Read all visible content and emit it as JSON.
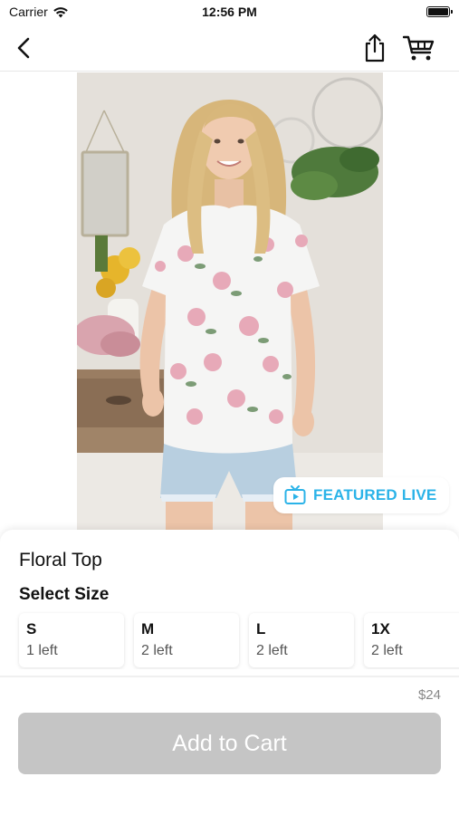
{
  "status_bar": {
    "carrier": "Carrier",
    "time": "12:56 PM"
  },
  "nav": {
    "back_icon": "chevron-left-icon",
    "share_icon": "share-icon",
    "cart_icon": "cart-icon"
  },
  "product": {
    "image": "woman wearing white floral short-sleeve top and denim shorts",
    "badge": {
      "icon": "tv-play-icon",
      "label": "FEATURED LIVE",
      "color": "#2bb3e8"
    },
    "title": "Floral Top",
    "select_size_label": "Select Size",
    "sizes": [
      {
        "name": "S",
        "stock": "1 left"
      },
      {
        "name": "M",
        "stock": "2 left"
      },
      {
        "name": "L",
        "stock": "2 left"
      },
      {
        "name": "1X",
        "stock": "2 left"
      }
    ],
    "price": "$24",
    "add_to_cart_label": "Add to Cart",
    "add_to_cart_color": "#c5c5c5"
  }
}
